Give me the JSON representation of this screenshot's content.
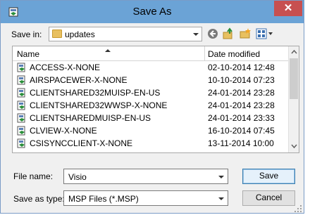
{
  "window": {
    "title": "Save As",
    "close_label": "✕"
  },
  "save_in": {
    "label": "Save in:",
    "folder": "updates"
  },
  "toolbar": {
    "icons": [
      "back-icon",
      "up-folder-icon",
      "new-folder-icon",
      "view-menu-icon"
    ]
  },
  "columns": {
    "name": "Name",
    "date_modified": "Date modified"
  },
  "files": [
    {
      "name": "ACCESS-X-NONE",
      "date": "02-10-2014 12:48"
    },
    {
      "name": "AIRSPACEWER-X-NONE",
      "date": "10-10-2014 07:23"
    },
    {
      "name": "CLIENTSHARED32MUISP-EN-US",
      "date": "24-01-2014 23:28"
    },
    {
      "name": "CLIENTSHARED32WWSP-X-NONE",
      "date": "24-01-2014 23:28"
    },
    {
      "name": "CLIENTSHAREDMUISP-EN-US",
      "date": "24-01-2014 23:33"
    },
    {
      "name": "CLVIEW-X-NONE",
      "date": "16-10-2014 07:45"
    },
    {
      "name": "CSISYNCCLIENT-X-NONE",
      "date": "13-11-2014 10:00"
    }
  ],
  "file_name": {
    "label": "File name:",
    "value": "Visio"
  },
  "save_as_type": {
    "label": "Save as type:",
    "value": "MSP Files (*.MSP)"
  },
  "buttons": {
    "save": "Save",
    "cancel": "Cancel"
  }
}
